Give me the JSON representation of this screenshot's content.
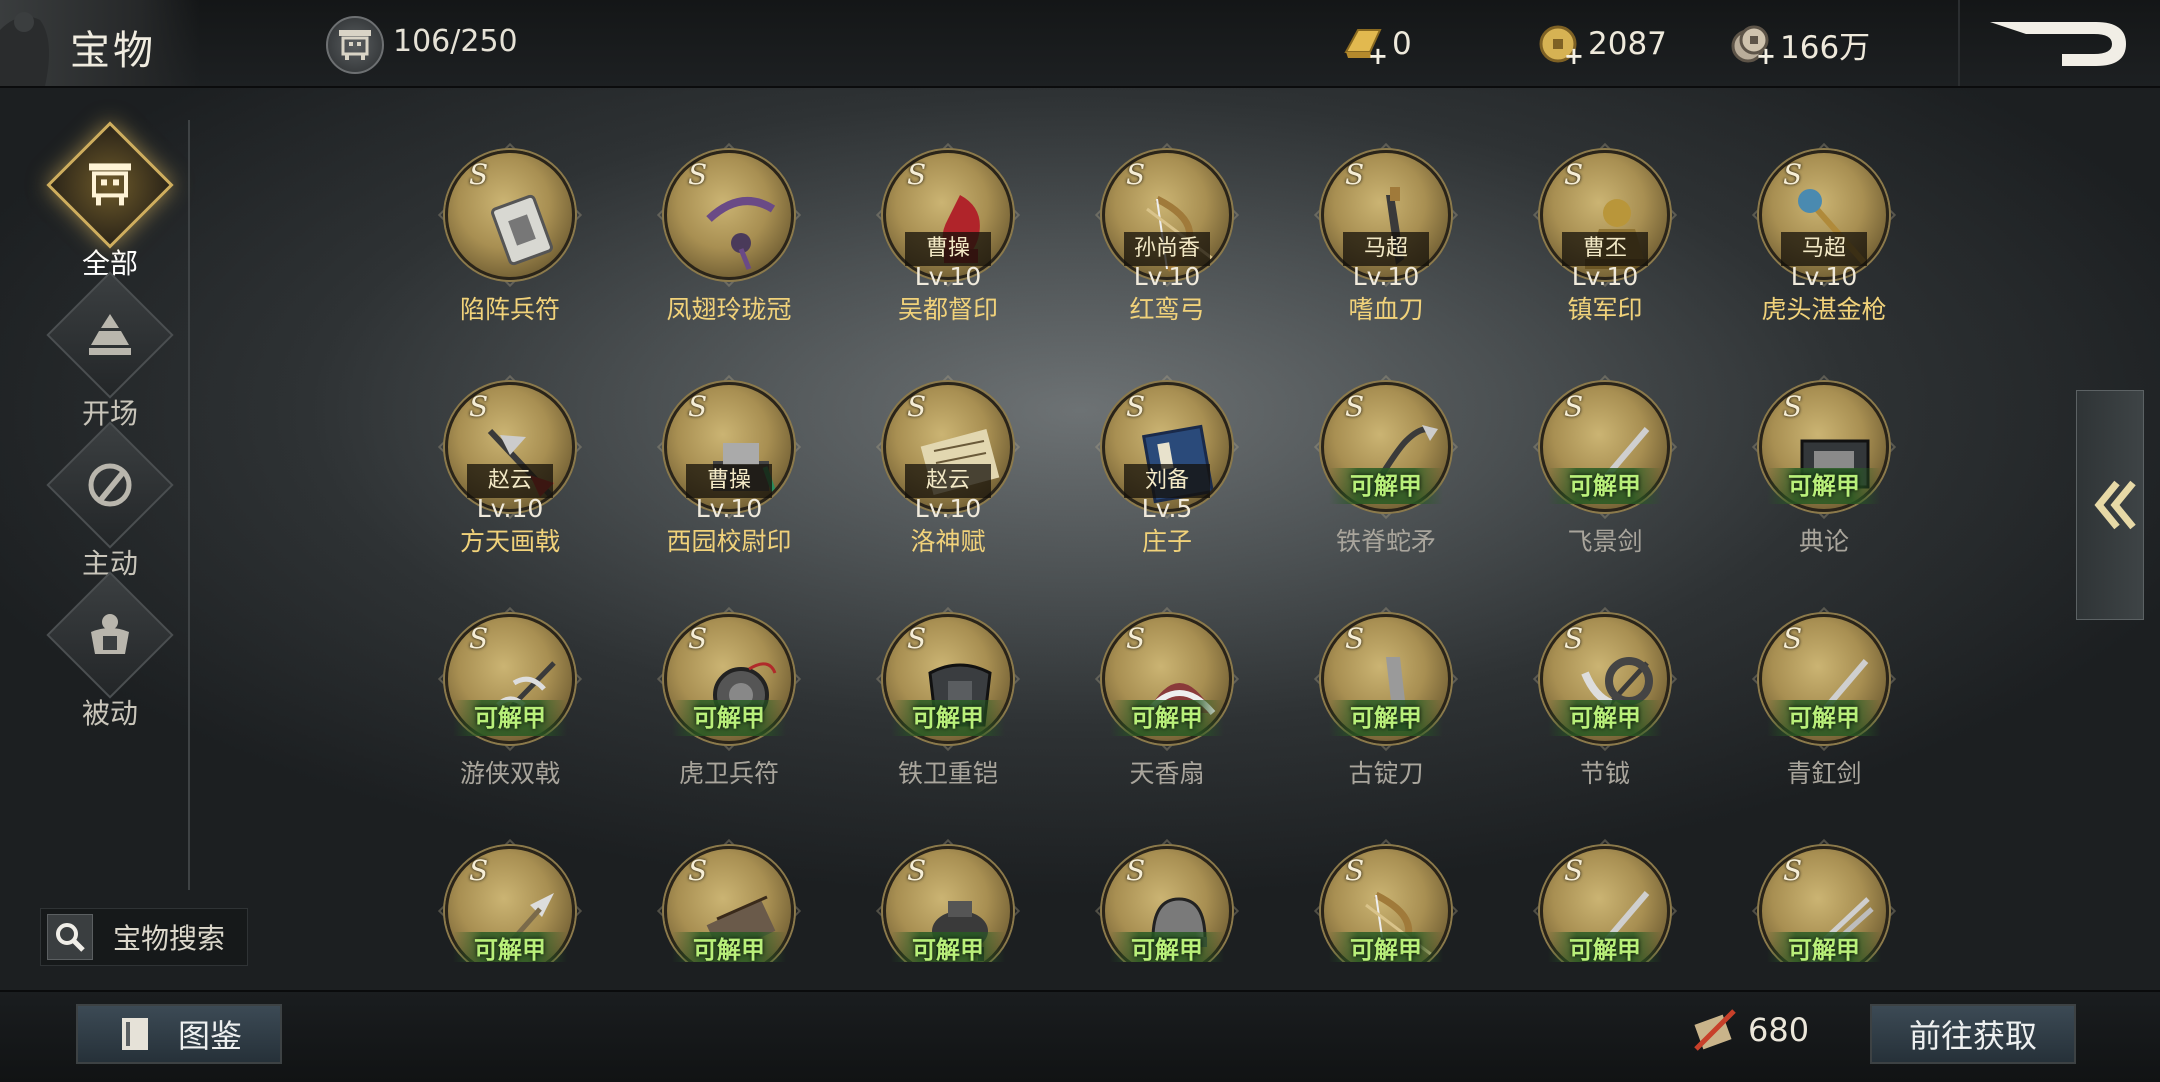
{
  "header": {
    "title": "宝物",
    "capacity": "106/250",
    "currencies": [
      {
        "icon": "gold-bar-icon",
        "value": "0"
      },
      {
        "icon": "gold-coin-icon",
        "value": "2087"
      },
      {
        "icon": "copper-coin-icon",
        "value": "166万"
      }
    ]
  },
  "sidebar": {
    "items": [
      {
        "label": "全部",
        "icon": "cauldron-icon",
        "active": true
      },
      {
        "label": "开场",
        "icon": "pyramid-icon",
        "active": false
      },
      {
        "label": "主动",
        "icon": "blade-circle-icon",
        "active": false
      },
      {
        "label": "被动",
        "icon": "armor-icon",
        "active": false
      }
    ],
    "search_label": "宝物搜索"
  },
  "treasures": [
    {
      "name": "陷阵兵符",
      "hero": "",
      "level": "",
      "unlock": "",
      "art": "tablet"
    },
    {
      "name": "凤翅玲珑冠",
      "hero": "",
      "level": "",
      "unlock": "",
      "art": "crown"
    },
    {
      "name": "吴都督印",
      "hero": "曹操",
      "level": "Lv.10",
      "unlock": "",
      "art": "seal-red"
    },
    {
      "name": "红鸾弓",
      "hero": "孙尚香",
      "level": "Lv.10",
      "unlock": "",
      "art": "bow"
    },
    {
      "name": "嗜血刀",
      "hero": "马超",
      "level": "Lv.10",
      "unlock": "",
      "art": "saber"
    },
    {
      "name": "镇军印",
      "hero": "曹丕",
      "level": "Lv.10",
      "unlock": "",
      "art": "seal-gold"
    },
    {
      "name": "虎头湛金枪",
      "hero": "马超",
      "level": "Lv.10",
      "unlock": "",
      "art": "spear"
    },
    {
      "name": "方天画戟",
      "hero": "赵云",
      "level": "Lv.10",
      "unlock": "",
      "art": "halberd"
    },
    {
      "name": "西园校尉印",
      "hero": "曹操",
      "level": "Lv.10",
      "unlock": "",
      "art": "seal-box"
    },
    {
      "name": "洛神赋",
      "hero": "赵云",
      "level": "Lv.10",
      "unlock": "",
      "art": "scroll"
    },
    {
      "name": "庄子",
      "hero": "刘备",
      "level": "Lv.5",
      "unlock": "",
      "art": "book"
    },
    {
      "name": "铁脊蛇矛",
      "hero": "",
      "level": "",
      "unlock": "可解甲",
      "art": "snake-spear"
    },
    {
      "name": "飞景剑",
      "hero": "",
      "level": "",
      "unlock": "可解甲",
      "art": "sword"
    },
    {
      "name": "典论",
      "hero": "",
      "level": "",
      "unlock": "可解甲",
      "art": "box"
    },
    {
      "name": "游侠双戟",
      "hero": "",
      "level": "",
      "unlock": "可解甲",
      "art": "twin-halberd"
    },
    {
      "name": "虎卫兵符",
      "hero": "",
      "level": "",
      "unlock": "可解甲",
      "art": "orb"
    },
    {
      "name": "铁卫重铠",
      "hero": "",
      "level": "",
      "unlock": "可解甲",
      "art": "armor"
    },
    {
      "name": "天香扇",
      "hero": "",
      "level": "",
      "unlock": "可解甲",
      "art": "fan"
    },
    {
      "name": "古锭刀",
      "hero": "",
      "level": "",
      "unlock": "可解甲",
      "art": "blade"
    },
    {
      "name": "节钺",
      "hero": "",
      "level": "",
      "unlock": "可解甲",
      "art": "axe"
    },
    {
      "name": "青釭剑",
      "hero": "",
      "level": "",
      "unlock": "可解甲",
      "art": "sword"
    },
    {
      "name": "",
      "hero": "",
      "level": "",
      "unlock": "可解甲",
      "art": "arrowhead"
    },
    {
      "name": "",
      "hero": "",
      "level": "",
      "unlock": "可解甲",
      "art": "bamboo"
    },
    {
      "name": "",
      "hero": "",
      "level": "",
      "unlock": "可解甲",
      "art": "censer"
    },
    {
      "name": "",
      "hero": "",
      "level": "",
      "unlock": "可解甲",
      "art": "helmet"
    },
    {
      "name": "",
      "hero": "",
      "level": "",
      "unlock": "可解甲",
      "art": "bow"
    },
    {
      "name": "",
      "hero": "",
      "level": "",
      "unlock": "可解甲",
      "art": "sword"
    },
    {
      "name": "",
      "hero": "",
      "level": "",
      "unlock": "可解甲",
      "art": "twin-sword"
    }
  ],
  "footer": {
    "codex_label": "图鉴",
    "points_icon": "scroll-quill-icon",
    "points": "680",
    "obtain_label": "前往获取"
  },
  "colors": {
    "owned_name": "#f1d27a",
    "locked_name": "#a9a59c",
    "unlock_badge": "#b9f07a",
    "medal_gold": "#a88f52"
  }
}
